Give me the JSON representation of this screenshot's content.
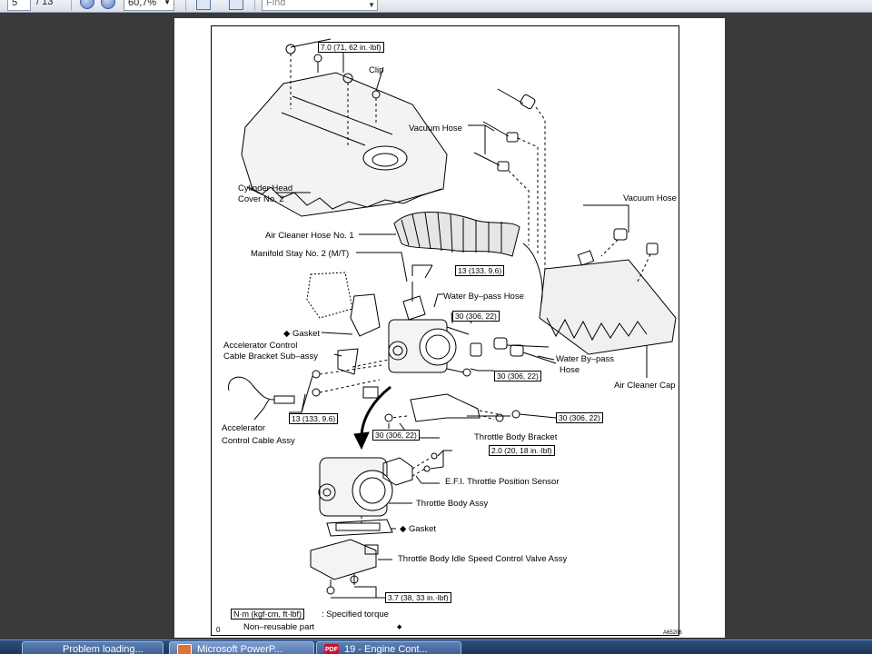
{
  "toolbar": {
    "page_current": "5",
    "page_total": "/ 13",
    "zoom": "60,7%",
    "find_placeholder": "Find"
  },
  "diagram": {
    "labels": {
      "torque_top": "7.0 (71, 62 in.·lbf)",
      "clip": "Clip",
      "vacuum_hose_1": "Vacuum Hose",
      "vacuum_hose_2": "Vacuum Hose",
      "cyl_head_cover_1": "Cylinder Head",
      "cyl_head_cover_2": "Cover No. 2",
      "air_cleaner_hose": "Air Cleaner Hose No. 1",
      "manifold_stay": "Manifold Stay No. 2 (M/T)",
      "torque_13a": "13 (133, 9.6)",
      "water_bypass_1": "Water By–pass Hose",
      "torque_30a": "30 (306, 22)",
      "gasket_1": "Gasket",
      "accel_bracket_1": "Accelerator Control",
      "accel_bracket_2": "Cable Bracket Sub–assy",
      "water_bypass_2a": "Water By–pass",
      "water_bypass_2b": "Hose",
      "torque_30b": "30 (306, 22)",
      "air_cleaner_cap": "Air Cleaner Cap",
      "torque_13b": "13 (133, 9.6)",
      "accel_cable_1": "Accelerator",
      "accel_cable_2": "Control Cable Assy",
      "torque_30c": "30 (306, 22)",
      "torque_30d": "30 (306, 22)",
      "throttle_bracket": "Throttle Body Bracket",
      "torque_2": "2.0 (20, 18 in.·lbf)",
      "efi_sensor": "E.F.I. Throttle Position Sensor",
      "throttle_body": "Throttle Body Assy",
      "gasket_2": "Gasket",
      "idle_valve": "Throttle Body Idle Speed Control Valve Assy",
      "torque_37": "3.7 (38, 33 in.·lbf)",
      "legend_units": "N·m (kgf·cm, ft·lbf)",
      "legend_torque": ": Specified torque",
      "legend_nonreusable": "Non–reusable part",
      "figure_id": "A65206",
      "page_mark": "0"
    }
  },
  "taskbar": {
    "items": [
      {
        "label": "Problem loading..."
      },
      {
        "label": "Microsoft PowerP..."
      },
      {
        "label": "19 - Engine Cont..."
      }
    ],
    "pdf_badge": "PDF"
  }
}
